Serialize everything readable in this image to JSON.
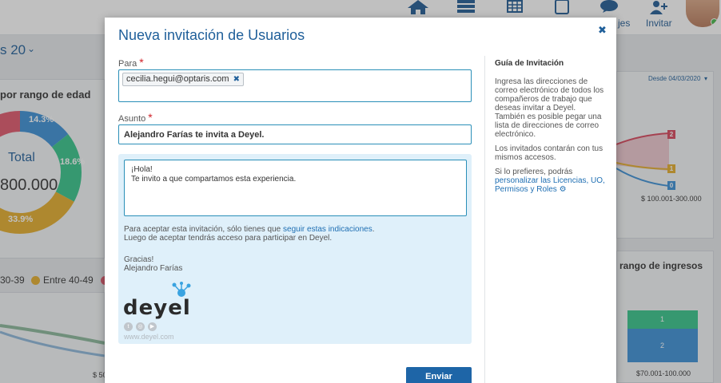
{
  "background": {
    "topbar": {
      "messages_label": "jes",
      "invite_label": "Invitar"
    },
    "left": {
      "month_selector": "s 20",
      "age_chart_title": "por rango de edad",
      "donut_total_label": "Total",
      "donut_total_value": "800.000",
      "donut_pct_1": "14.3%",
      "donut_pct_2": "18.6%",
      "donut_pct_3": "33.9%",
      "legend_1": "30-39",
      "legend_2": "Entre 40-49",
      "axis_label": "$ 50"
    },
    "right": {
      "date_filter": "Desde 04/03/2020",
      "badge_2": "2",
      "badge_1": "1",
      "badge_0": "0",
      "range_label": "$ 100.001-300.000",
      "income_chart_title": "rango de ingresos",
      "bar_1": "1",
      "bar_2": "2",
      "income_axis_label": "$70.001-100.000"
    }
  },
  "modal": {
    "title": "Nueva invitación de Usuarios",
    "to_label": "Para",
    "recipient_email": "cecilia.hegui@optaris.com",
    "subject_label": "Asunto",
    "subject_value": "Alejandro Farías te invita a Deyel.",
    "message_value": "¡Hola!\nTe invito a que compartamos esta experiencia.",
    "accept_text_before": "Para aceptar esta invitación, sólo tienes que ",
    "accept_link": "seguir estas indicaciones",
    "accept_text_after": ".",
    "after_accept_text": "Luego de aceptar tendrás acceso para participar en Deyel.",
    "thanks": "Gracias!",
    "sender_name": "Alejandro Farías",
    "logo_text": "deyel",
    "website": "www.deyel.com",
    "send_button": "Enviar",
    "guide": {
      "title": "Guía de Invitación",
      "p1": "Ingresa las direcciones de correo electrónico de todos los compañeros de trabajo que deseas invitar a Deyel. También es posible pegar una lista de direcciones de correo electrónico.",
      "p2": "Los invitados contarán con tus mismos accesos.",
      "p3_prefix": "Si lo prefieres, podrás",
      "p3_link": "personalizar las Licencias, UO, Permisos y Roles"
    }
  },
  "colors": {
    "primary": "#1f5f9a",
    "button": "#1e65a7",
    "input_border": "#2a8fb8",
    "body_panel": "#dff0fa",
    "required": "#d0232a",
    "donut_blue": "#3a8fd6",
    "donut_green": "#34c48a",
    "donut_orange": "#e5ad2a",
    "donut_red": "#e0566b"
  }
}
